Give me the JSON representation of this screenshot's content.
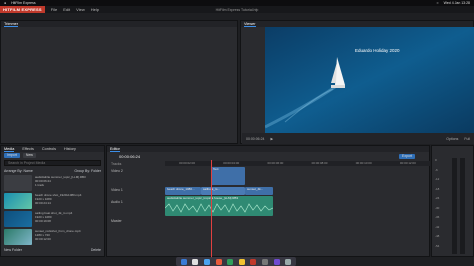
{
  "mac_menu": {
    "apple": "",
    "app": "HitFilm Express",
    "clock": "Wed 4 Jan 13:28"
  },
  "window": {
    "title": "HitFilm Express Tutorial.hfp",
    "brand": "HITFILM EXPRESS",
    "menu": [
      "File",
      "Edit",
      "View",
      "Help"
    ]
  },
  "trimmer": {
    "tab": "Trimmer"
  },
  "viewer": {
    "tab": "Viewer",
    "overlay_text": "Eduardo Holiday 2020",
    "timecode": "00:00:06:24",
    "options_label": "Options",
    "zoom": "Full"
  },
  "media": {
    "tabs": [
      "Media",
      "Effects",
      "Controls",
      "History"
    ],
    "import_label": "Import",
    "new_label": "New",
    "search_placeholder": "Search in Project Media",
    "arrange_label": "Arrange By: Name",
    "group_label": "Group By: Folder",
    "items": [
      {
        "name": "audiofalnlie summer_topic_[LLM].RB3",
        "line2": "00:00:06:24",
        "line3": "1 track"
      },
      {
        "name": "beach drone shot_1920x1080.mp4",
        "line2": "1920 x 1080",
        "line3": "00:00:24:14"
      },
      {
        "name": "sailing boat shot_4k_rs.mp4",
        "line2": "1920 x 1080",
        "line3": "00:00:19:08"
      },
      {
        "name": "sunset_rockshot_from_drone.mp4",
        "line2": "1280 x 720",
        "line3": "00:00:12:00"
      }
    ],
    "new_folder": "New Folder",
    "delete_label": "Delete"
  },
  "editor": {
    "tab": "Editor",
    "timecode": "00:00:06:24",
    "export_label": "Export",
    "tracks_label": "Tracks",
    "tracks": [
      "Video 2",
      "Video 1",
      "Audio 1",
      "Master"
    ],
    "ruler": [
      "00:00:02:00",
      "00:00:04:00",
      "00:00:06:00",
      "00:00:08:00",
      "00:00:10:00",
      "00:00:12:00"
    ],
    "clips": {
      "text_clip": "Text",
      "video1a": "beach drone_1080...",
      "video1b": "sailboat_rs...",
      "video1c": "sunset_4k...",
      "audio": "audiofalnlie summer_topic_tropical.house_[LLM].RB3"
    }
  },
  "meters": {
    "scale": [
      "0",
      "-6",
      "-12",
      "-18",
      "-24",
      "-30",
      "-36",
      "-42",
      "-48",
      "-54"
    ]
  },
  "colors": {
    "accent": "#3b8ee8",
    "brand": "#c0392b",
    "playhead": "#e04040",
    "video_clip": "#3f6fa8",
    "audio_clip": "#2f8a73"
  }
}
